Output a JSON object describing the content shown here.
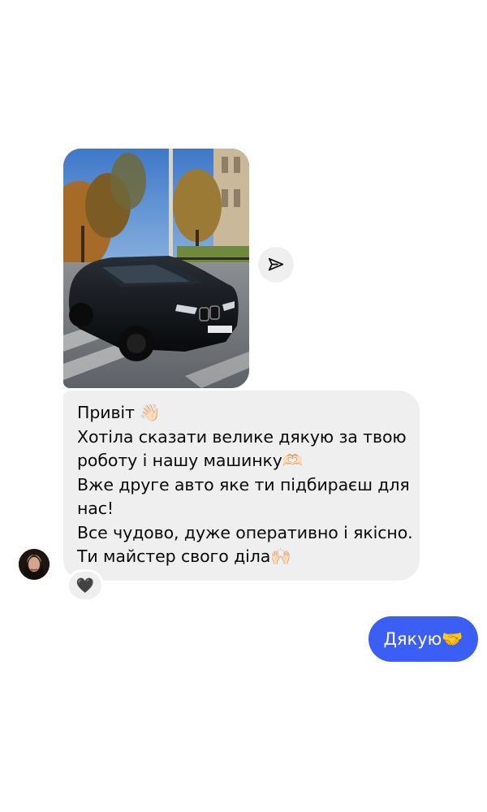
{
  "conversation": {
    "photo_message": {
      "alt": "Фото автомобіля"
    },
    "share_button": {
      "icon": "send-icon"
    },
    "contact": {
      "avatar": "avatar"
    },
    "incoming_message": {
      "lines": [
        "Привіт 👋🏻",
        "Хотіла сказати велике дякую за твою",
        "роботу і нашу машинку🫶🏻",
        "Вже друге авто яке ти підбираєш для",
        "нас!",
        "Все чудово, дуже оперативно і якісно.",
        "Ти майстер свого діла🙌🏻"
      ],
      "reaction": "🖤"
    },
    "outgoing_message": {
      "text": "Дякую🤝"
    }
  },
  "colors": {
    "incoming_bubble": "#efefef",
    "outgoing_bubble": "#3b5ef4",
    "outgoing_text": "#ffffff"
  }
}
